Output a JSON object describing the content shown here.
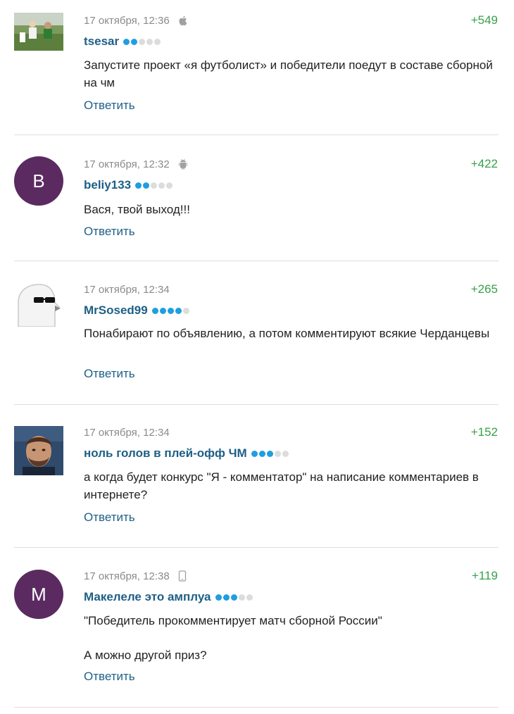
{
  "reply_label": "Ответить",
  "colors": {
    "accent": "#1e5f86",
    "rating": "#36a04a",
    "avatar_bg": "#5b2a61",
    "dot_on": "#1f9ee0",
    "dot_off": "#dcdcdc"
  },
  "comments": [
    {
      "date": "17 октября, 12:36",
      "device": "apple-icon",
      "rating": "+549",
      "author": "tsesar",
      "level": 2,
      "avatar": "photo-football",
      "text": [
        "Запустите проект «я футболист» и победители поедут в составе сборной на чм"
      ]
    },
    {
      "date": "17 октября, 12:32",
      "device": "android-icon",
      "rating": "+422",
      "author": "beliy133",
      "level": 2,
      "avatar_letter": "B",
      "text": [
        "Вася, твой выход!!!"
      ]
    },
    {
      "date": "17 октября, 12:34",
      "device": "",
      "rating": "+265",
      "author": "MrSosed99",
      "level": 4,
      "avatar": "bird-sunglasses",
      "text": [
        "Понабирают по объявлению, а потом комментируют всякие Черданцевы"
      ]
    },
    {
      "date": "17 октября, 12:34",
      "device": "",
      "rating": "+152",
      "author": "ноль голов в плей-офф ЧМ",
      "level": 3,
      "avatar": "photo-player",
      "text": [
        "а когда будет конкурс \"Я - комментатор\" на написание комментариев в интернете?"
      ]
    },
    {
      "date": "17 октября, 12:38",
      "device": "mobile-icon",
      "rating": "+119",
      "author": "Макелеле это амплуа",
      "level": 3,
      "avatar_letter": "M",
      "text": [
        "\"Победитель прокомментирует матч сборной России\"",
        "А можно другой приз?"
      ]
    }
  ]
}
